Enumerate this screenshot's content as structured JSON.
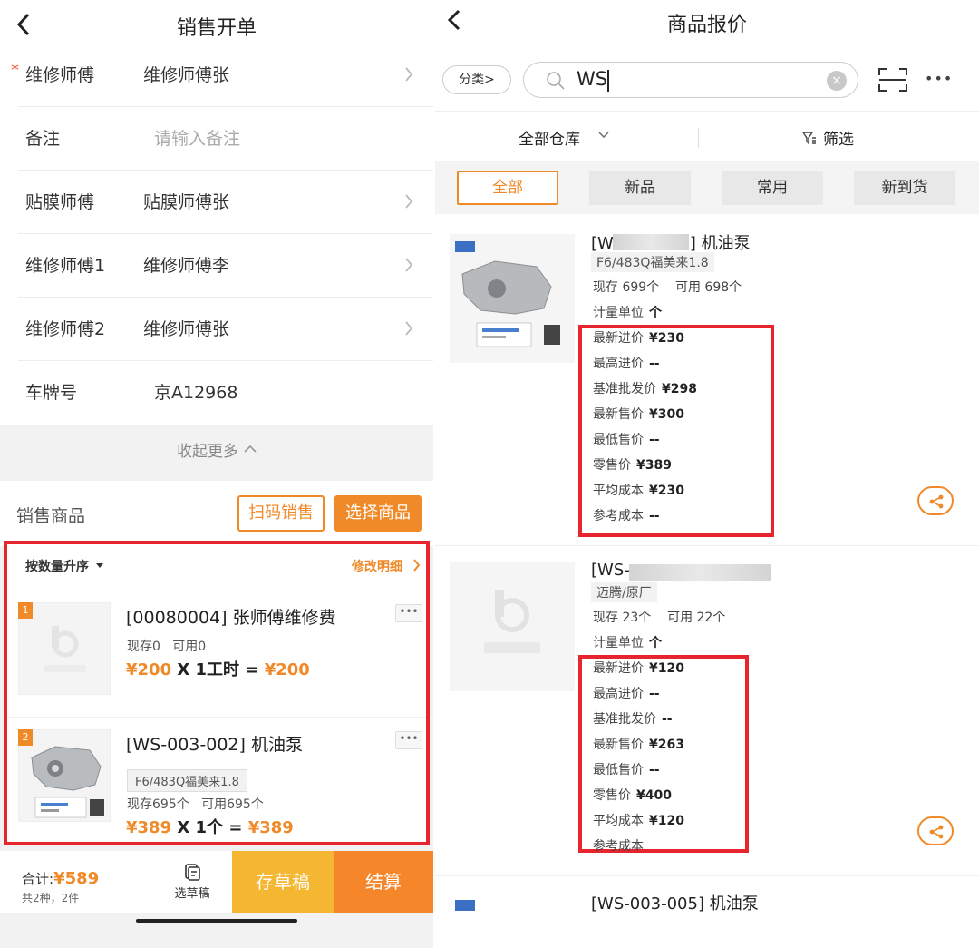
{
  "left": {
    "title": "销售开单",
    "form": {
      "repair_master": {
        "label": "维修师傅",
        "value": "维修师傅张",
        "required_mark": "*"
      },
      "remark": {
        "label": "备注",
        "placeholder": "请输入备注"
      },
      "film_master": {
        "label": "贴膜师傅",
        "value": "贴膜师傅张"
      },
      "repair_master1": {
        "label": "维修师傅1",
        "value": "维修师傅李"
      },
      "repair_master2": {
        "label": "维修师傅2",
        "value": "维修师傅张"
      },
      "plate": {
        "label": "车牌号",
        "value": "京A12968"
      }
    },
    "collapse_label": "收起更多",
    "sale_goods_label": "销售商品",
    "scan_sale_label": "扫码销售",
    "choose_goods_label": "选择商品",
    "sort_label": "按数量升序",
    "edit_detail_label": "修改明细",
    "items": [
      {
        "index": "1",
        "name": "[00080004] 张师傅维修费",
        "stock": "现存0",
        "available": "可用0",
        "unit_price": "¥200",
        "qty": "X 1工时 =",
        "subtotal": "¥200",
        "more": "•••"
      },
      {
        "index": "2",
        "name": "[WS-003-002] 机油泵",
        "tag": "F6/483Q福美来1.8",
        "stock": "现存695个",
        "available": "可用695个",
        "unit_price": "¥389",
        "qty": "X 1个 =",
        "subtotal": "¥389",
        "more": "•••"
      }
    ],
    "footer": {
      "total_label": "合计:",
      "total_value": "¥589",
      "count_text": "共2种，2件",
      "pick_draft_label": "选草稿",
      "save_draft_label": "存草稿",
      "settle_label": "结算"
    }
  },
  "right": {
    "title": "商品报价",
    "category_label": "分类>",
    "search_value": "WS",
    "clear_icon": "×",
    "more_icon": "•••",
    "warehouse_label": "全部仓库",
    "filter_label": "筛选",
    "tabs": [
      "全部",
      "新品",
      "常用",
      "新到货"
    ],
    "products": [
      {
        "name": "[WS-003-002] 机油泵",
        "name_visible": "[W",
        "name_tail": "] 机油泵",
        "tag": "F6/483Q福美来1.8",
        "stock": "现存  699个",
        "available": "可用  698个",
        "unit_line": {
          "label": "计量单位",
          "value": "个"
        },
        "prices": [
          {
            "label": "最新进价",
            "value": "¥230"
          },
          {
            "label": "最高进价",
            "value": "--"
          },
          {
            "label": "基准批发价",
            "value": "¥298"
          },
          {
            "label": "最新售价",
            "value": "¥300"
          },
          {
            "label": "最低售价",
            "value": "--"
          },
          {
            "label": "零售价",
            "value": "¥389"
          },
          {
            "label": "平均成本",
            "value": "¥230"
          },
          {
            "label": "参考成本",
            "value": "--"
          }
        ]
      },
      {
        "name_visible": "[WS-",
        "tag": "迈腾/原厂",
        "stock": "现存  23个",
        "available": "可用  22个",
        "unit_line": {
          "label": "计量单位",
          "value": "个"
        },
        "prices": [
          {
            "label": "最新进价",
            "value": "¥120"
          },
          {
            "label": "最高进价",
            "value": "--"
          },
          {
            "label": "基准批发价",
            "value": "--"
          },
          {
            "label": "最新售价",
            "value": "¥263"
          },
          {
            "label": "最低售价",
            "value": "--"
          },
          {
            "label": "零售价",
            "value": "¥400"
          },
          {
            "label": "平均成本",
            "value": "¥120"
          },
          {
            "label": "参考成本",
            "value": ""
          }
        ]
      },
      {
        "name": "[WS-003-005] 机油泵"
      }
    ]
  },
  "colors": {
    "accent": "#f08a28",
    "highlight": "#e8242f",
    "draft": "#f5b731",
    "settle": "#f5862a"
  }
}
